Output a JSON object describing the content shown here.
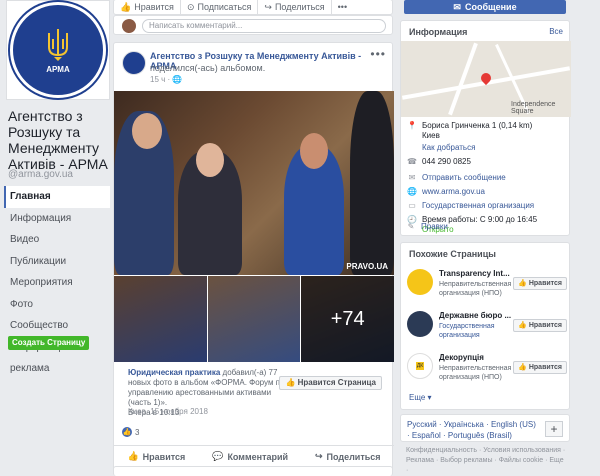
{
  "page": {
    "name": "Агентство з Розшуку та Менеджменту Активів - АРМА",
    "handle": "@arma.gov.ua",
    "logo_text": "АРМА"
  },
  "nav": {
    "items": [
      "Главная",
      "Информация",
      "Видео",
      "Публикации",
      "Мероприятия",
      "Фото",
      "Сообщество",
      "Информация и реклама"
    ],
    "create_button": "Создать Страницу"
  },
  "top_actions": {
    "like": "Нравится",
    "follow": "Подписаться",
    "share": "Поделиться",
    "more": "•••",
    "comment_placeholder": "Написать комментарий..."
  },
  "post": {
    "author": "Агентство з Розшуку та Менеджменту Активів - АРМА",
    "subtitle": "поделился(-ась) альбомом.",
    "time": "15 ч",
    "more": "•••",
    "watermark": "PRAVO.UA",
    "extra_photos": "+74",
    "shared_author": "Юридическая практика",
    "shared_text": "добавил(-а) 77 новых фото в альбом «ФОРМА. Форум по управлению арестованными активами (часть 1)».",
    "shared_time": "Вчера в 10:13",
    "like_page_button": "Нравится Страница",
    "location": "Киев, 15 ноября 2018",
    "reaction_count": "3",
    "actions": {
      "like": "Нравится",
      "comment": "Комментарий",
      "share": "Поделиться"
    }
  },
  "message_button": "Сообщение",
  "info": {
    "title": "Информация",
    "all_link": "Все",
    "map_label": "Independence Square",
    "address": "Бориса Гринченка 1 (0,14 km)",
    "city": "Киев",
    "directions": "Как добраться",
    "phone": "044 290 0825",
    "send_message": "Отправить сообщение",
    "website": "www.arma.gov.ua",
    "category": "Государственная организация",
    "hours": "Время работы: С 9:00 до 16:45",
    "open_status": "Открыто",
    "rules": "Правки"
  },
  "similar": {
    "title": "Похожие Страницы",
    "items": [
      {
        "name": "Transparency Int...",
        "desc": "Неправительственная организация (НПО)",
        "button": "Нравится"
      },
      {
        "name": "Державне бюро ...",
        "desc": "Государственная организация",
        "button": "Нравится"
      },
      {
        "name": "Декорупція",
        "desc": "Неправительственная организация (НПО)",
        "button": "Нравится"
      }
    ],
    "more": "Еще"
  },
  "languages": {
    "text": "Русский · Українська · English (US) · Español · Português (Brasil)",
    "plus": "+"
  },
  "footer": {
    "text": "Конфиденциальность · Условия использования · Реклама · Выбор рекламы · Файлы cookie · Еще ·"
  },
  "colors": {
    "facebook_blue": "#4267b2",
    "link": "#385898",
    "green": "#42b72a",
    "logo_blue": "#1f3f8f"
  }
}
